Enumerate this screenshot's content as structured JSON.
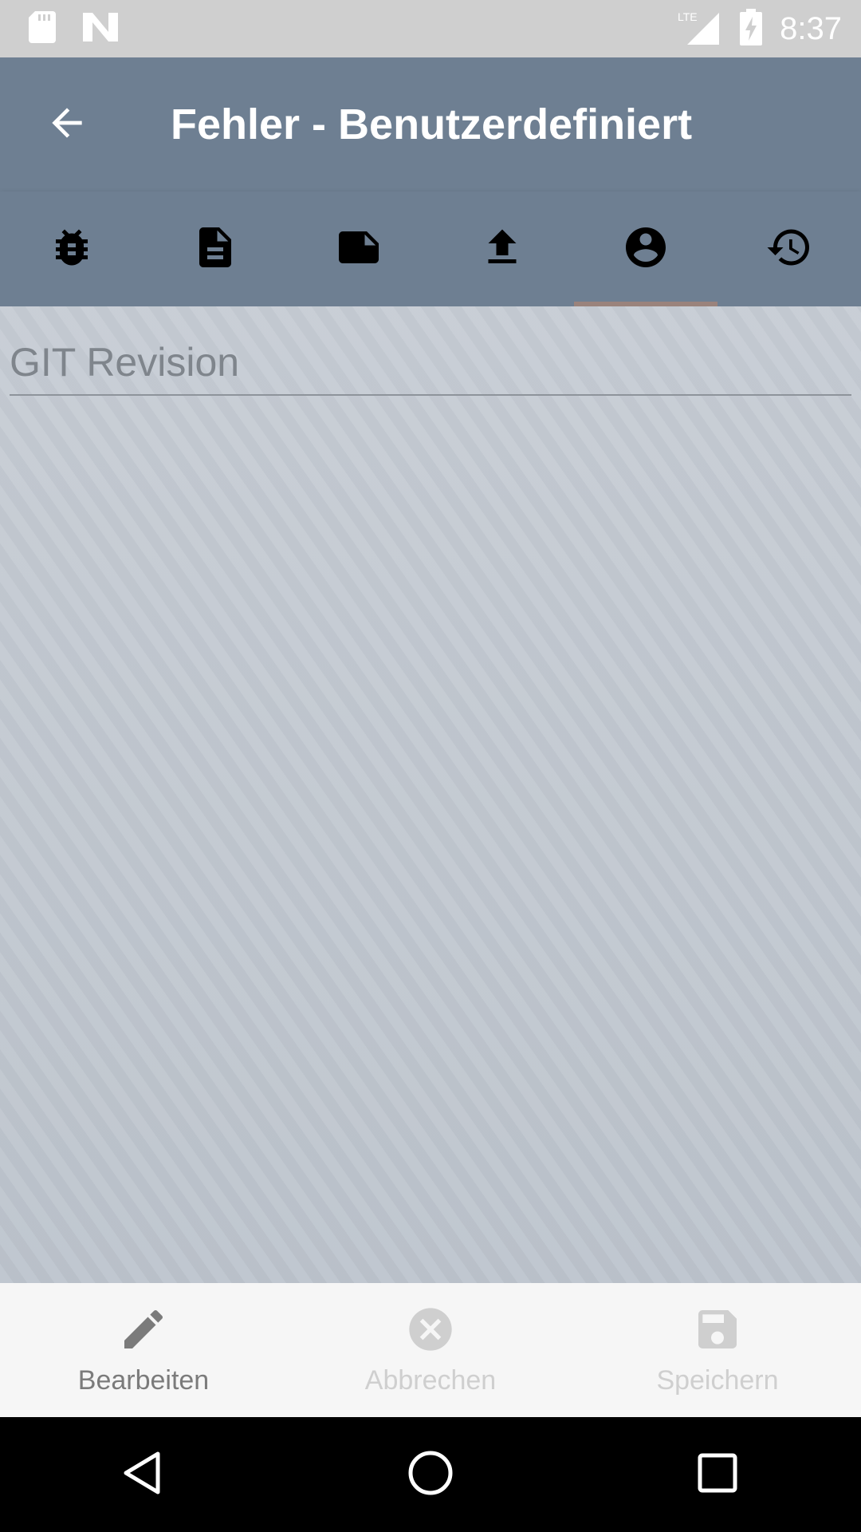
{
  "status_bar": {
    "time": "8:37",
    "network": "LTE",
    "icons": [
      "sd-card-icon",
      "notification-n-icon",
      "lte-signal-icon",
      "battery-charging-icon"
    ]
  },
  "app_bar": {
    "title": "Fehler - Benutzerdefiniert",
    "back_icon": "arrow-back-icon"
  },
  "tabs": [
    {
      "icon": "bug-icon",
      "active": false
    },
    {
      "icon": "document-icon",
      "active": false
    },
    {
      "icon": "note-icon",
      "active": false
    },
    {
      "icon": "upload-icon",
      "active": false
    },
    {
      "icon": "account-circle-icon",
      "active": true
    },
    {
      "icon": "history-icon",
      "active": false
    }
  ],
  "form": {
    "git_revision": {
      "placeholder": "GIT Revision",
      "value": ""
    }
  },
  "actions": {
    "edit_label": "Bearbeiten",
    "cancel_label": "Abbrechen",
    "save_label": "Speichern"
  },
  "colors": {
    "app_bar": "#6e7f92",
    "status_bar": "#cfcfcf",
    "content_bg": "#c4cad2",
    "tab_indicator": "#b7866e",
    "bottom_bar": "#f6f6f6"
  }
}
